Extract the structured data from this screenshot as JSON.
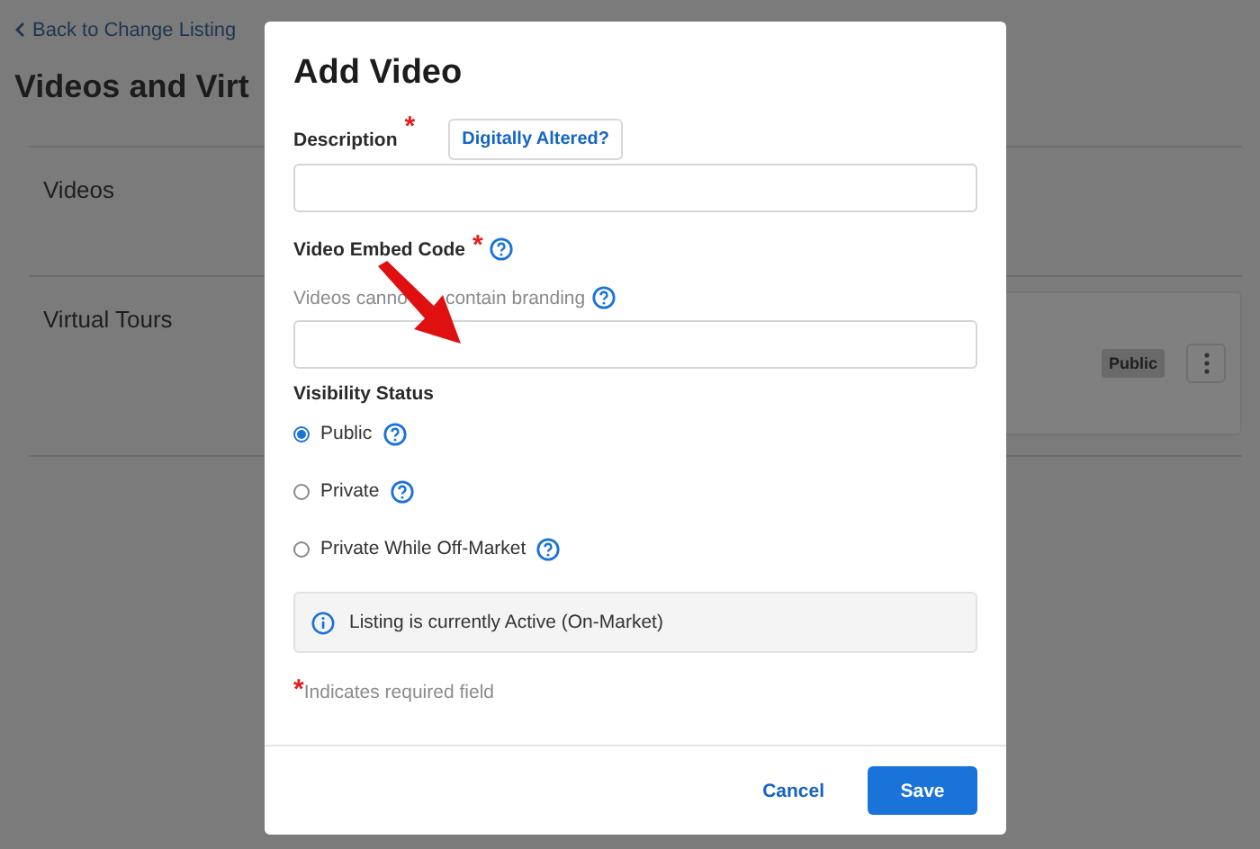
{
  "background": {
    "back_link": "Back to Change Listing",
    "title": "Videos and Virt",
    "sections": [
      {
        "label": "Videos"
      },
      {
        "label": "Virtual Tours",
        "card": {
          "badge": "Public"
        }
      }
    ]
  },
  "modal": {
    "title": "Add Video",
    "description": {
      "label": "Description",
      "required_mark": "*",
      "action": "Digitally Altered?"
    },
    "embed_code": {
      "label": "Video Embed Code",
      "required_mark": "*",
      "hint": [
        "Videos canno",
        "contain branding"
      ]
    },
    "visibility": {
      "label": "Visibility Status",
      "options": [
        {
          "label": "Public",
          "selected": true
        },
        {
          "label": "Private",
          "selected": false
        },
        {
          "label": "Private While Off-Market",
          "selected": false
        }
      ]
    },
    "info": "Listing is currently Active (On-Market)",
    "required_note": {
      "mark": "*",
      "text": "Indicates required field"
    },
    "buttons": {
      "cancel": "Cancel",
      "save": "Save"
    }
  }
}
